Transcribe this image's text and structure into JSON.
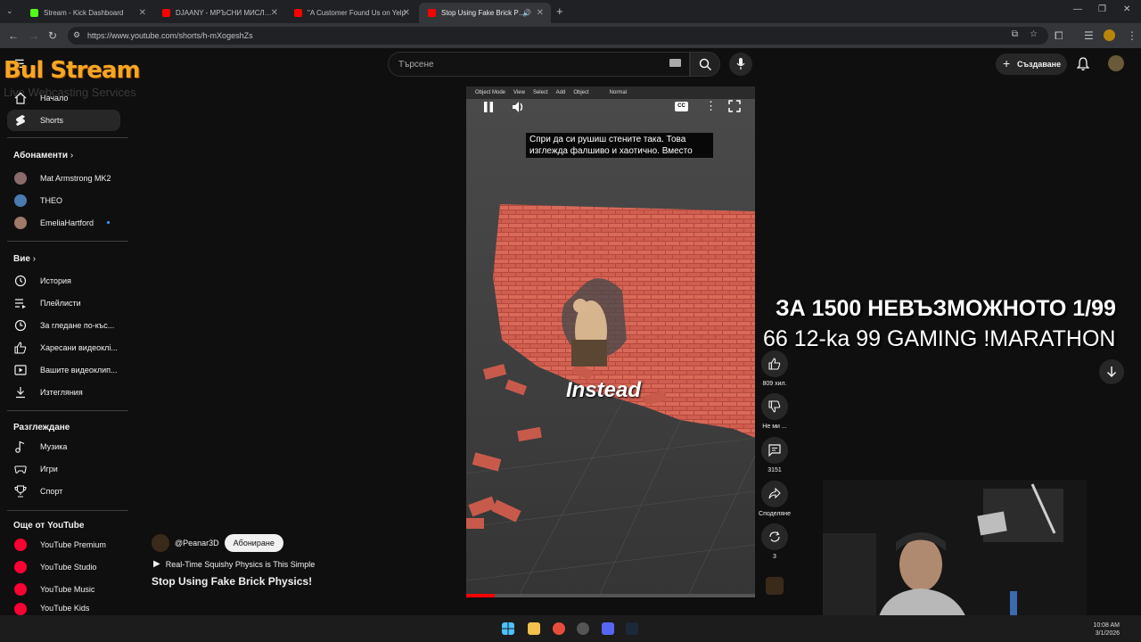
{
  "browser": {
    "tabs": [
      {
        "label": "Stream - Kick Dashboard",
        "color": "#53fc18"
      },
      {
        "label": "DJAANY - МРЪСНИ МИСЛИ (",
        "color": "#ff0000"
      },
      {
        "label": "\"A Customer Found Us on Yelp",
        "color": "#ff0000"
      },
      {
        "label": "Stop Using Fake Brick Physi",
        "color": "#ff0000"
      }
    ],
    "url": "https://www.youtube.com/shorts/h-mXogeshZs",
    "new_tab": "+"
  },
  "header": {
    "search_placeholder": "Търсене",
    "create_label": "Създаване"
  },
  "overlay_logo": {
    "main": "Bul Stream",
    "sub": "Live Webcasting Services"
  },
  "sidebar": {
    "top_items": [
      {
        "label": "Начало",
        "icon": "home-icon"
      },
      {
        "label": "Shorts",
        "icon": "shorts-icon"
      }
    ],
    "subscriptions_title": "Абонаменти",
    "subscriptions": [
      {
        "label": "Mat Armstrong MK2",
        "color": "#8a6a6a"
      },
      {
        "label": "THEO",
        "color": "#4a7ab0"
      },
      {
        "label": "EmeliaHartford",
        "color": "#a07a6a"
      }
    ],
    "you_title": "Вие",
    "you_items": [
      {
        "label": "История",
        "icon": "history-icon"
      },
      {
        "label": "Плейлисти",
        "icon": "playlist-icon"
      },
      {
        "label": "За гледане по-къс...",
        "icon": "clock-icon"
      },
      {
        "label": "Харесани видеоклі...",
        "icon": "like-icon"
      },
      {
        "label": "Вашите видеоклип...",
        "icon": "video-icon"
      },
      {
        "label": "Изтегляния",
        "icon": "download-icon"
      }
    ],
    "explore_title": "Разглеждане",
    "explore_items": [
      {
        "label": "Музика",
        "icon": "music-icon"
      },
      {
        "label": "Игри",
        "icon": "games-icon"
      },
      {
        "label": "Спорт",
        "icon": "trophy-icon"
      }
    ],
    "more_title": "Още от YouTube",
    "more_items": [
      {
        "label": "YouTube Premium"
      },
      {
        "label": "YouTube Studio"
      },
      {
        "label": "YouTube Music"
      },
      {
        "label": "YouTube Kids"
      }
    ]
  },
  "player": {
    "blender_menu": [
      "Object Mode",
      "View",
      "Select",
      "Add",
      "Object",
      "Normal"
    ],
    "caption_line1": "Спри да си рушиш стените така.  Това",
    "caption_line2": "изглежда фалшиво и хаотично.  Вместо",
    "overlay_word": "Instead",
    "progress": 0.1
  },
  "actions": {
    "likes": "809 хил.",
    "dislike": "Не ми ...",
    "comments": "3151",
    "share": "Споделяне",
    "remix": "3"
  },
  "short_info": {
    "channel": "@Peanar3D",
    "subscribe": "Абониране",
    "music": "Real-Time Squishy Physics is This Simple",
    "title": "Stop Using Fake Brick Physics!"
  },
  "stream_overlay": {
    "line1": "ЗА 1500 НЕВЪЗМОЖНОТО 1/99",
    "line2": "66 12-ka 99 GAMING !MARATHON"
  },
  "taskbar": {
    "time": "10:08 AM",
    "date": "3/1/2026"
  }
}
